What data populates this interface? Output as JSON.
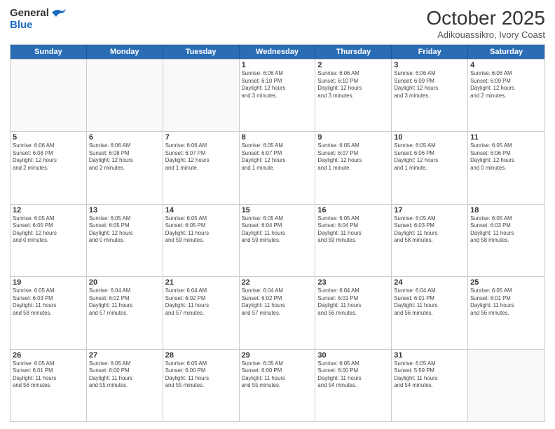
{
  "header": {
    "logo_general": "General",
    "logo_blue": "Blue",
    "month_title": "October 2025",
    "subtitle": "Adikouassikro, Ivory Coast"
  },
  "days_of_week": [
    "Sunday",
    "Monday",
    "Tuesday",
    "Wednesday",
    "Thursday",
    "Friday",
    "Saturday"
  ],
  "weeks": [
    [
      {
        "day": "",
        "info": ""
      },
      {
        "day": "",
        "info": ""
      },
      {
        "day": "",
        "info": ""
      },
      {
        "day": "1",
        "info": "Sunrise: 6:06 AM\nSunset: 6:10 PM\nDaylight: 12 hours\nand 3 minutes."
      },
      {
        "day": "2",
        "info": "Sunrise: 6:06 AM\nSunset: 6:10 PM\nDaylight: 12 hours\nand 3 minutes."
      },
      {
        "day": "3",
        "info": "Sunrise: 6:06 AM\nSunset: 6:09 PM\nDaylight: 12 hours\nand 3 minutes."
      },
      {
        "day": "4",
        "info": "Sunrise: 6:06 AM\nSunset: 6:09 PM\nDaylight: 12 hours\nand 2 minutes."
      }
    ],
    [
      {
        "day": "5",
        "info": "Sunrise: 6:06 AM\nSunset: 6:08 PM\nDaylight: 12 hours\nand 2 minutes."
      },
      {
        "day": "6",
        "info": "Sunrise: 6:06 AM\nSunset: 6:08 PM\nDaylight: 12 hours\nand 2 minutes."
      },
      {
        "day": "7",
        "info": "Sunrise: 6:06 AM\nSunset: 6:07 PM\nDaylight: 12 hours\nand 1 minute."
      },
      {
        "day": "8",
        "info": "Sunrise: 6:05 AM\nSunset: 6:07 PM\nDaylight: 12 hours\nand 1 minute."
      },
      {
        "day": "9",
        "info": "Sunrise: 6:05 AM\nSunset: 6:07 PM\nDaylight: 12 hours\nand 1 minute."
      },
      {
        "day": "10",
        "info": "Sunrise: 6:05 AM\nSunset: 6:06 PM\nDaylight: 12 hours\nand 1 minute."
      },
      {
        "day": "11",
        "info": "Sunrise: 6:05 AM\nSunset: 6:06 PM\nDaylight: 12 hours\nand 0 minutes."
      }
    ],
    [
      {
        "day": "12",
        "info": "Sunrise: 6:05 AM\nSunset: 6:05 PM\nDaylight: 12 hours\nand 0 minutes."
      },
      {
        "day": "13",
        "info": "Sunrise: 6:05 AM\nSunset: 6:05 PM\nDaylight: 12 hours\nand 0 minutes."
      },
      {
        "day": "14",
        "info": "Sunrise: 6:05 AM\nSunset: 6:05 PM\nDaylight: 11 hours\nand 59 minutes."
      },
      {
        "day": "15",
        "info": "Sunrise: 6:05 AM\nSunset: 6:04 PM\nDaylight: 11 hours\nand 59 minutes."
      },
      {
        "day": "16",
        "info": "Sunrise: 6:05 AM\nSunset: 6:04 PM\nDaylight: 11 hours\nand 59 minutes."
      },
      {
        "day": "17",
        "info": "Sunrise: 6:05 AM\nSunset: 6:03 PM\nDaylight: 11 hours\nand 58 minutes."
      },
      {
        "day": "18",
        "info": "Sunrise: 6:05 AM\nSunset: 6:03 PM\nDaylight: 11 hours\nand 58 minutes."
      }
    ],
    [
      {
        "day": "19",
        "info": "Sunrise: 6:05 AM\nSunset: 6:03 PM\nDaylight: 11 hours\nand 58 minutes."
      },
      {
        "day": "20",
        "info": "Sunrise: 6:04 AM\nSunset: 6:02 PM\nDaylight: 11 hours\nand 57 minutes."
      },
      {
        "day": "21",
        "info": "Sunrise: 6:04 AM\nSunset: 6:02 PM\nDaylight: 11 hours\nand 57 minutes."
      },
      {
        "day": "22",
        "info": "Sunrise: 6:04 AM\nSunset: 6:02 PM\nDaylight: 11 hours\nand 57 minutes."
      },
      {
        "day": "23",
        "info": "Sunrise: 6:04 AM\nSunset: 6:01 PM\nDaylight: 11 hours\nand 56 minutes."
      },
      {
        "day": "24",
        "info": "Sunrise: 6:04 AM\nSunset: 6:01 PM\nDaylight: 11 hours\nand 56 minutes."
      },
      {
        "day": "25",
        "info": "Sunrise: 6:05 AM\nSunset: 6:01 PM\nDaylight: 11 hours\nand 56 minutes."
      }
    ],
    [
      {
        "day": "26",
        "info": "Sunrise: 6:05 AM\nSunset: 6:01 PM\nDaylight: 11 hours\nand 56 minutes."
      },
      {
        "day": "27",
        "info": "Sunrise: 6:05 AM\nSunset: 6:00 PM\nDaylight: 11 hours\nand 55 minutes."
      },
      {
        "day": "28",
        "info": "Sunrise: 6:05 AM\nSunset: 6:00 PM\nDaylight: 11 hours\nand 55 minutes."
      },
      {
        "day": "29",
        "info": "Sunrise: 6:05 AM\nSunset: 6:00 PM\nDaylight: 11 hours\nand 55 minutes."
      },
      {
        "day": "30",
        "info": "Sunrise: 6:05 AM\nSunset: 6:00 PM\nDaylight: 11 hours\nand 54 minutes."
      },
      {
        "day": "31",
        "info": "Sunrise: 6:05 AM\nSunset: 5:59 PM\nDaylight: 11 hours\nand 54 minutes."
      },
      {
        "day": "",
        "info": ""
      }
    ]
  ]
}
